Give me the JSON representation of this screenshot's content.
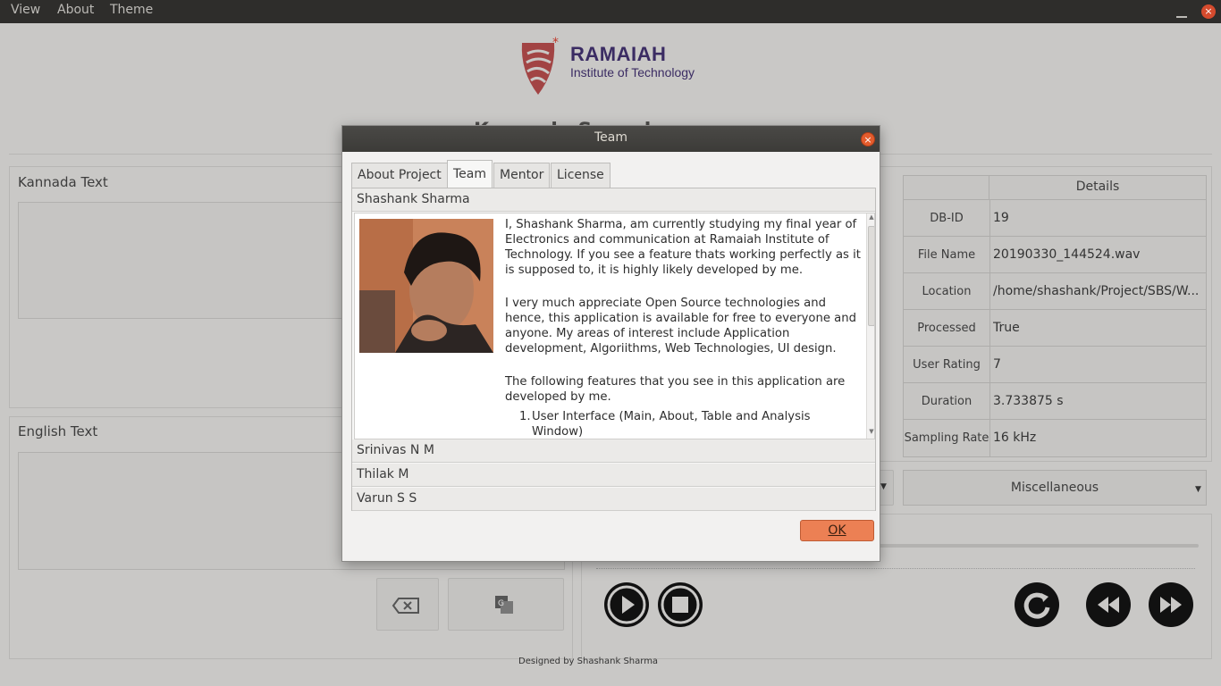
{
  "menubar": {
    "items": [
      {
        "label": "View"
      },
      {
        "label": "About"
      },
      {
        "label": "Theme"
      }
    ],
    "close_label": "×"
  },
  "header": {
    "logo_title": "RAMAIAH",
    "logo_subtitle": "Institute of Technology",
    "app_title": "Kannada Speech Synthesis"
  },
  "left_panel": {
    "kannada_label": "Kannada Text",
    "english_label": "English Text"
  },
  "details": {
    "header": "Details",
    "rows": [
      {
        "key": "DB-ID",
        "value": "19"
      },
      {
        "key": "File Name",
        "value": "20190330_144524.wav"
      },
      {
        "key": "Location",
        "value": "/home/shashank/Project/SBS/W..."
      },
      {
        "key": "Processed",
        "value": "True"
      },
      {
        "key": "User Rating",
        "value": "7"
      },
      {
        "key": "Duration",
        "value": "3.733875 s"
      },
      {
        "key": "Sampling Rate",
        "value": "16 kHz"
      }
    ],
    "misc_label": "Miscellaneous"
  },
  "dialog": {
    "title": "Team",
    "close_label": "×",
    "tabs": [
      {
        "label": "About Project",
        "active": false
      },
      {
        "label": "Team",
        "active": true
      },
      {
        "label": "Mentor",
        "active": false
      },
      {
        "label": "License",
        "active": false
      }
    ],
    "members": [
      {
        "name": "Shashank Sharma",
        "expanded": true
      },
      {
        "name": "Srinivas  N M",
        "expanded": false
      },
      {
        "name": "Thilak M",
        "expanded": false
      },
      {
        "name": "Varun S S",
        "expanded": false
      }
    ],
    "bio": {
      "p1": "I, Shashank Sharma, am currently studying my final year of Electronics and communication at Ramaiah Institute of Technology. If you see a feature thats working perfectly as it is supposed to, it is highly likely developed by me.",
      "p2": "I very much appreciate Open Source technologies and hence, this application is available for free to everyone and anyone. My areas of interest include Application development, Algoriithms, Web Technologies, UI design.",
      "p3": "The following features that you see in this application are developed by me.",
      "list": [
        "User Interface (Main, About, Table and Analysis Window)"
      ]
    },
    "ok_label": "OK"
  },
  "footer": {
    "text": "Designed by Shashank Sharma"
  },
  "colors": {
    "accent": "#ec8054",
    "titlebar": "#3c3b38",
    "close": "#e45c2d"
  }
}
